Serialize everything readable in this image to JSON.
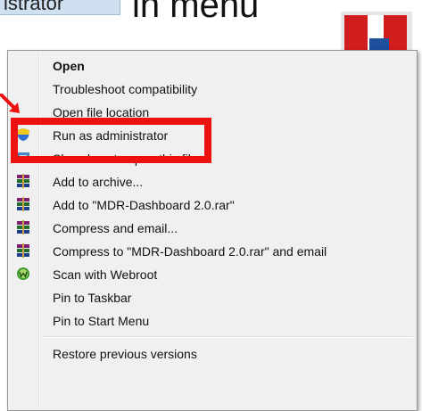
{
  "fragments": {
    "label": "istrator",
    "title": "in menu"
  },
  "menu": {
    "items": [
      {
        "label": "Open",
        "bold": true,
        "icon": ""
      },
      {
        "label": "Troubleshoot compatibility",
        "icon": ""
      },
      {
        "label": "Open file location",
        "icon": ""
      },
      {
        "label": "Run as administrator",
        "icon": "uac-shield-icon"
      },
      {
        "label": "Show how to open this file",
        "icon": "info-icon"
      },
      {
        "label": "Add to archive...",
        "icon": "winrar-icon"
      },
      {
        "label": "Add to \"MDR-Dashboard 2.0.rar\"",
        "icon": "winrar-icon"
      },
      {
        "label": "Compress and email...",
        "icon": "winrar-icon"
      },
      {
        "label": "Compress to \"MDR-Dashboard 2.0.rar\" and email",
        "icon": "winrar-icon"
      },
      {
        "label": "Scan with Webroot",
        "icon": "webroot-icon"
      },
      {
        "label": "Pin to Taskbar",
        "icon": ""
      },
      {
        "label": "Pin to Start Menu",
        "icon": ""
      },
      {
        "label": "Restore previous versions",
        "icon": ""
      }
    ]
  },
  "annotation": {
    "highlight_color": "#ee1111",
    "highlighted_item": "Run as administrator"
  }
}
